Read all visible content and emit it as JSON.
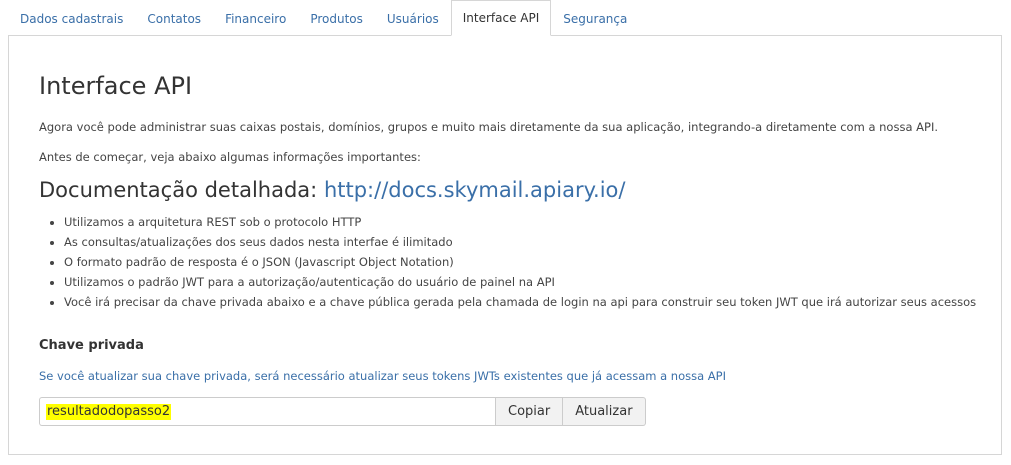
{
  "tabs": [
    {
      "label": "Dados cadastrais",
      "active": false
    },
    {
      "label": "Contatos",
      "active": false
    },
    {
      "label": "Financeiro",
      "active": false
    },
    {
      "label": "Produtos",
      "active": false
    },
    {
      "label": "Usuários",
      "active": false
    },
    {
      "label": "Interface API",
      "active": true
    },
    {
      "label": "Segurança",
      "active": false
    }
  ],
  "main": {
    "title": "Interface API",
    "intro": "Agora você pode administrar suas caixas postais, domínios, grupos e muito mais diretamente da sua aplicação, integrando-a diretamente com a nossa API.",
    "before": "Antes de começar, veja abaixo algumas informações importantes:",
    "doc_heading": "Documentação detalhada:",
    "doc_link": "http://docs.skymail.apiary.io/",
    "features": [
      "Utilizamos a arquitetura REST sob o protocolo HTTP",
      "As consultas/atualizações dos seus dados nesta interfae é ilimitado",
      "O formato padrão de resposta é o JSON (Javascript Object Notation)",
      "Utilizamos o padrão JWT para a autorização/autenticação do usuário de painel na API",
      "Você irá precisar da chave privada abaixo e a chave pública gerada pela chamada de login na api para construir seu token JWT que irá autorizar seus acessos"
    ],
    "key_section": {
      "title": "Chave privada",
      "note": "Se você atualizar sua chave privada, será necessário atualizar seus tokens JWTs existentes que já acessam a nossa API",
      "value": "resultadodopasso2",
      "copy_label": "Copiar",
      "refresh_label": "Atualizar",
      "highlight_color": "#ffff00"
    }
  },
  "colors": {
    "link": "#3a6fa8",
    "border": "#d6d6d6",
    "text": "#333333"
  }
}
